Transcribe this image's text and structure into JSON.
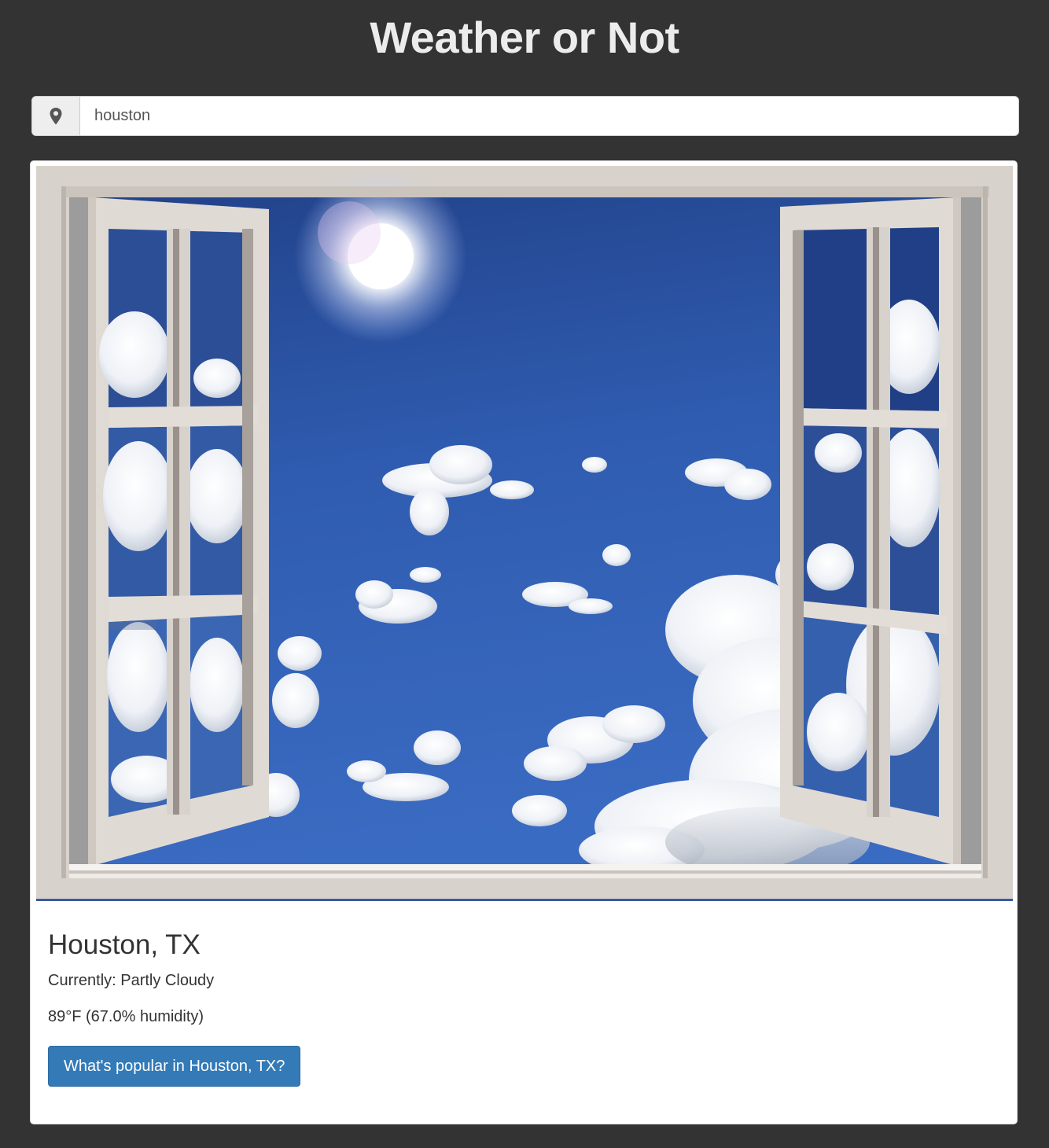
{
  "app": {
    "title": "Weather or Not"
  },
  "search": {
    "value": "houston",
    "icon": "map-marker-icon"
  },
  "result": {
    "image_icon": "open-window-sunny-sky",
    "city": "Houston, TX",
    "conditions": "Currently: Partly Cloudy",
    "temperature": "89°F (67.0% humidity)",
    "popular_button_label": "What's popular in Houston, TX?"
  },
  "colors": {
    "background": "#333333",
    "card": "#ffffff",
    "button": "#337ab7",
    "sky": "#2f5aa8"
  }
}
